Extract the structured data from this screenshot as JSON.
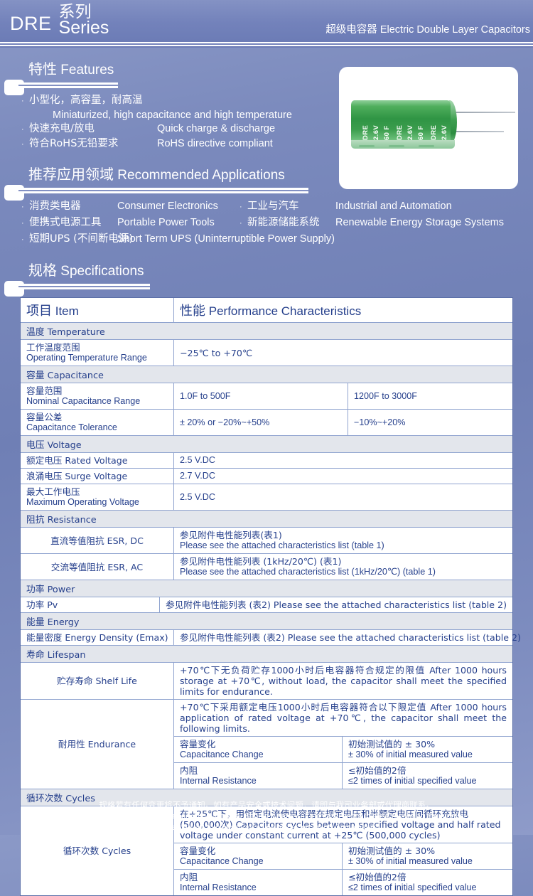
{
  "header": {
    "brand": "DRE",
    "series_cn": "系列",
    "series_en": "Series",
    "subtitle_cn": "超级电容器",
    "subtitle_en": "Electric Double Layer Capacitors"
  },
  "product_photo": {
    "label_lines": [
      "DRE",
      "2.6V",
      "60 F",
      "DRE",
      "2.6V",
      "60 F",
      "DRE",
      "2.6V"
    ]
  },
  "features": {
    "title_cn": "特性",
    "title_en": "Features",
    "items": [
      {
        "cn": "小型化，高容量，耐高温",
        "en": "Miniaturized, high capacitance and high temperature",
        "stacked": true
      },
      {
        "cn": "快速充电/放电",
        "en": "Quick charge & discharge",
        "stacked": false
      },
      {
        "cn": "符合RoHS无铅要求",
        "en": "RoHS directive compliant",
        "stacked": false
      }
    ]
  },
  "applications": {
    "title_cn": "推荐应用领域",
    "title_en": "Recommended Applications",
    "rows": [
      {
        "cn1": "消费类电器",
        "en1": "Consumer Electronics",
        "cn2": "工业与汽车",
        "en2": "Industrial and Automation"
      },
      {
        "cn1": "便携式电源工具",
        "en1": "Portable Power Tools",
        "cn2": "新能源储能系统",
        "en2": "Renewable Energy Storage Systems"
      },
      {
        "cn1": "短期UPS (不间断电源)",
        "en1": "Short Term UPS (Uninterruptible Power Supply)",
        "cn2": "",
        "en2": ""
      }
    ]
  },
  "specifications": {
    "title_cn": "规格",
    "title_en": "Specifications",
    "head_item_cn": "项目",
    "head_item_en": "Item",
    "head_perf_cn": "性能",
    "head_perf_en": "Performance Characteristics",
    "groups": {
      "temperature": "温度 Temperature",
      "capacitance": "容量 Capacitance",
      "voltage": "电压 Voltage",
      "resistance": "阻抗 Resistance",
      "power": "功率 Power",
      "energy": "能量 Energy",
      "lifespan": "寿命 Lifespan",
      "cycles": "循环次数 Cycles"
    },
    "rows": {
      "operating_temp": {
        "label_cn": "工作温度范围",
        "label_en": "Operating Temperature Range",
        "value": "−25℃ to +70℃"
      },
      "nominal_cap": {
        "label_cn": "容量范围",
        "label_en": "Nominal Capacitance Range",
        "value_a": "1.0F to 500F",
        "value_b": "1200F to 3000F"
      },
      "cap_tolerance": {
        "label_cn": "容量公差",
        "label_en": "Capacitance Tolerance",
        "value_a": "± 20% or −20%~+50%",
        "value_b": "−10%~+20%"
      },
      "rated_voltage": {
        "label": "额定电压 Rated Voltage",
        "value": "2.5 V.DC"
      },
      "surge_voltage": {
        "label": "浪涌电压 Surge Voltage",
        "value": "2.7 V.DC"
      },
      "max_operating_voltage": {
        "label_cn": "最大工作电压",
        "label_en": "Maximum Operating Voltage",
        "value": "2.5 V.DC"
      },
      "esr_dc": {
        "label": "直流等值阻抗 ESR, DC",
        "value_cn": "参见附件电性能列表(表1)",
        "value_en": "Please see the attached characteristics list (table 1)"
      },
      "esr_ac": {
        "label": "交流等值阻抗 ESR, AC",
        "value_cn": "参见附件电性能列表 (1kHz/20℃) (表1)",
        "value_en": "Please see the attached characteristics list (1kHz/20℃) (table 1)"
      },
      "power_pv": {
        "label": "功率 Pv",
        "value": "参见附件电性能列表 (表2) Please see the attached characteristics list (table 2)"
      },
      "energy_density": {
        "label": "能量密度 Energy Density (Emax)",
        "value": "参见附件电性能列表 (表2) Please see the attached characteristics list (table 2)"
      },
      "shelf_life": {
        "label": "贮存寿命 Shelf Life",
        "value_cn": "+70℃下无负荷贮存1000小时后电容器符合规定的限值",
        "value_en": "After 1000 hours storage at +70℃, without load, the capacitor shall meet the specified limits for endurance."
      },
      "endurance": {
        "label": "耐用性 Endurance",
        "intro_cn": "+70℃下采用额定电压1000小时后电容器符合以下限定值",
        "intro_en": "After 1000 hours application of rated voltage at +70℃, the capacitor shall meet the following limits.",
        "sub": [
          {
            "name_cn": "容量变化",
            "name_en": "Capacitance Change",
            "val_cn": "初始测试值的 ± 30%",
            "val_en": "± 30% of initial measured value"
          },
          {
            "name_cn": "内阻",
            "name_en": "Internal Resistance",
            "val_cn": "≤初始值的2倍",
            "val_en": "≤2 times of initial specified value"
          }
        ]
      },
      "cycles": {
        "label": "循环次数 Cycles",
        "intro_cn": "在+25℃下，用恒定电流使电容器在规定电压和半额定电压间循环充放电 (500,000次)",
        "intro_en": "Capacitors cycles between specified voltage and half rated voltage under constant current at +25℃ (500,000 cycles)",
        "sub": [
          {
            "name_cn": "容量变化",
            "name_en": "Capacitance Change",
            "val_cn": "初始测试值的 ± 30%",
            "val_en": "± 30% of initial measured value"
          },
          {
            "name_cn": "内阻",
            "name_en": "Internal Resistance",
            "val_cn": "≤初始值的2倍",
            "val_en": "≤2 times of initial specified value"
          }
        ]
      }
    }
  },
  "footer": {
    "line1": "规格若有任何变更将不予通知。如有产品安全或技术问题，请即与我司业务部或代理商联系。",
    "line2": "Specifications are subject to change without notice. Should a safety or technical concern arise regarding the product,",
    "line3": "please be sure to contact our sales offices or agents immediately."
  },
  "colors": {
    "background_blue": "#7383b8",
    "table_text": "#26408c",
    "group_row": "#e3e6ec",
    "capacitor_green": "#2f9444"
  }
}
